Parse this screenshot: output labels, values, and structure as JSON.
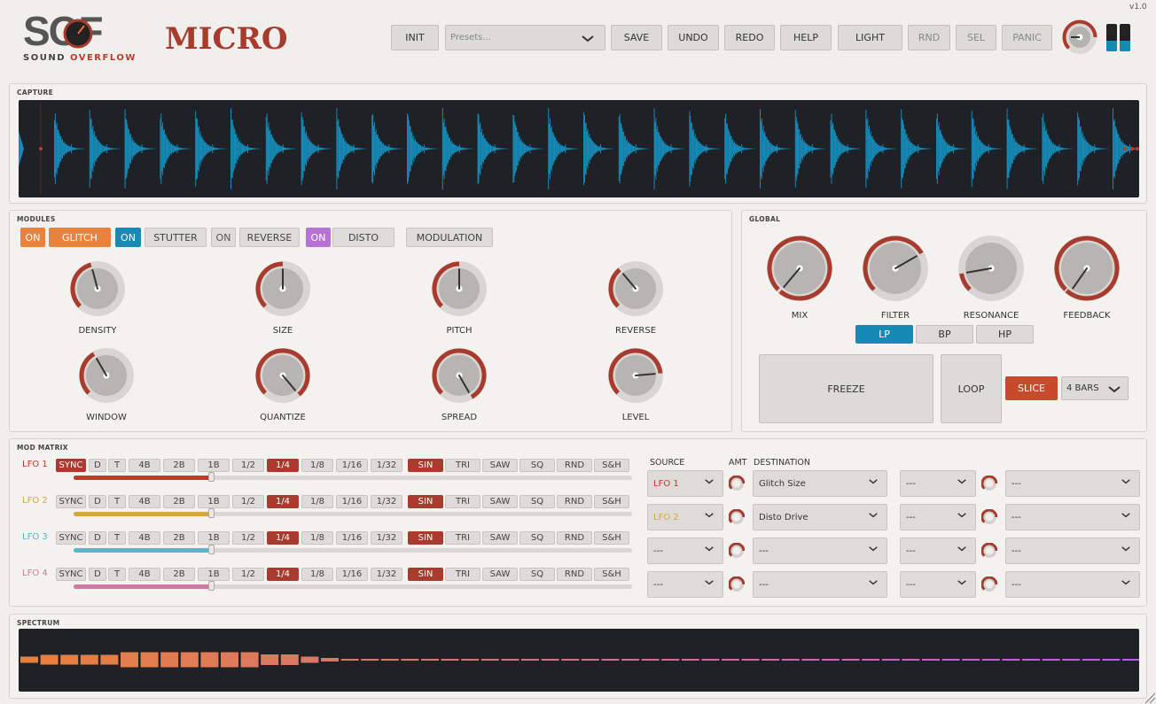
{
  "app": {
    "logo_text": "SOF",
    "brand_sub_1": "SOUND",
    "brand_sub_2": "OVERFLOW",
    "title": "MICRO",
    "version": "v1.0"
  },
  "toolbar": {
    "init": "INIT",
    "presets_placeholder": "Presets...",
    "save": "SAVE",
    "undo": "UNDO",
    "redo": "REDO",
    "help": "HELP",
    "light": "LIGHT",
    "rnd": "RND",
    "sel": "SEL",
    "panic": "PANIC"
  },
  "capture": {
    "title": "CAPTURE"
  },
  "modules": {
    "title": "MODULES",
    "on_label": "ON",
    "items": [
      "GLITCH",
      "STUTTER",
      "REVERSE",
      "DISTO"
    ],
    "modulation": "MODULATION",
    "knobs": [
      "DENSITY",
      "SIZE",
      "PITCH",
      "REVERSE",
      "WINDOW",
      "QUANTIZE",
      "SPREAD",
      "LEVEL"
    ]
  },
  "global": {
    "title": "GLOBAL",
    "knobs": [
      "MIX",
      "FILTER",
      "RESONANCE",
      "FEEDBACK"
    ],
    "filter_types": [
      "LP",
      "BP",
      "HP"
    ],
    "selected_filter": "LP",
    "freeze": "FREEZE",
    "loop": "LOOP",
    "slice": "SLICE",
    "bars": "4 BARS"
  },
  "mod_matrix": {
    "title": "MOD MATRIX",
    "lfos": [
      "LFO 1",
      "LFO 2",
      "LFO 3",
      "LFO 4"
    ],
    "rate_options": [
      "SYNC",
      "D",
      "T",
      "4B",
      "2B",
      "1B",
      "1/2",
      "1/4",
      "1/8",
      "1/16",
      "1/32"
    ],
    "shape_options": [
      "SIN",
      "TRI",
      "SAW",
      "SQ",
      "RND",
      "S&H"
    ],
    "selected_rate": "1/4",
    "selected_shape": "SIN",
    "source_header": "SOURCE",
    "amt_header": "AMT",
    "dest_header": "DESTINATION",
    "slots_left": [
      {
        "source": "LFO 1",
        "dest": "Glitch Size"
      },
      {
        "source": "LFO 2",
        "dest": "Disto Drive"
      },
      {
        "source": "---",
        "dest": "---"
      },
      {
        "source": "---",
        "dest": "---"
      }
    ],
    "slots_right": [
      {
        "source": "---",
        "dest": "---"
      },
      {
        "source": "---",
        "dest": "---"
      },
      {
        "source": "---",
        "dest": "---"
      },
      {
        "source": "---",
        "dest": "---"
      }
    ]
  },
  "spectrum": {
    "title": "SPECTRUM"
  },
  "colors": {
    "accent_red": "#a83a2e",
    "orange": "#e8823c",
    "teal": "#1789b5",
    "purple": "#b772d6",
    "lfo1": "#c0392b",
    "lfo2": "#d9a441",
    "lfo3": "#4cbccc",
    "lfo4": "#d377a4"
  }
}
